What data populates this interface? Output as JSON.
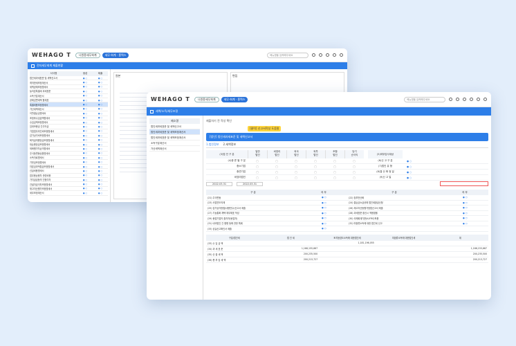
{
  "back": {
    "logo": "WEHAGO T",
    "pill": "나원종세무회계",
    "pill2": "세무·회계 · 홈택스",
    "bar_title": "전자세무회계 제출현황",
    "search": "메뉴명을 입력해주세요",
    "col1": "서식명",
    "col2": "생성",
    "col3": "제출",
    "panel2": "원본",
    "panel3": "편집",
    "rows": [
      "법인세과세표준 및 세액신고서",
      "최저한세조정계산서",
      "세액공제조정명세서",
      "농어촌특별세 과세표준",
      "소득구분계산서",
      "공제감면세액 합계표",
      "특별비용조정명세서",
      "가산세액계산서",
      "이월결손금명세서",
      "조정후수입금액명세서",
      "수입금액조정명세서",
      "임대보증금 간주익금",
      "기업업무추진비조정명세서",
      "감가상각비조정명세서",
      "퇴직급여충당금조정명세서",
      "대손충당금조정명세서",
      "외화평가차손익명세서",
      "주식등변동상황명세서",
      "소득자료명세서",
      "기부금조정명세서",
      "자본금과적립금조정명세서",
      "선급비용명세서",
      "업무용승용차 관련비용",
      "가지급금등의 인정이자",
      "건설자금이자조정명세서",
      "재고자산평가조정명세서",
      "세무조정계산서"
    ]
  },
  "front": {
    "logo": "WEHAGO T",
    "pill": "나원종세무회계",
    "pill2": "세무·회계 · 홈택스",
    "bar_title": "세액/소득/세무조정",
    "search": "메뉴명을 입력해주세요",
    "sub_title": "[법인] 법인세과세표준 및 세액신고서",
    "help": "제출하기 전 작성 확인",
    "tooltip": "[클릭] 신고서작성 도움말",
    "left_header": "제소명",
    "left_items": [
      "법인세과세표준 및 세액신고서",
      "법인세과세표준 및 세액조정계산서",
      "법인세과세표준 및 세액조정계산서",
      "소득구분계산서",
      "가산세액계산서"
    ],
    "tab1": "1.법인정보",
    "tab2": "2.세액정보",
    "section_label": "법인\n구분",
    "header_cols": [
      "일반\n법인",
      "비영리\n법인",
      "외국\n법인",
      "외투\n법인",
      "조합\n법인",
      "당기\n순이익"
    ],
    "r_labels": [
      "(3)법 인 구 분",
      "(4)종 류 별 구 분",
      "중소기업",
      "중견기업",
      "비영리법인",
      "(5)외부감사대상",
      "(6)신 고 구 분",
      "(7)법인 유 형",
      "(8)결 산 확 정 일",
      "(9)신 고 일",
      "(10)세무조정번호"
    ],
    "dates": [
      "2022.03.31",
      "2022.03.31"
    ],
    "mid_header": [
      "구 분",
      "여 부",
      "구 분",
      "여 부"
    ],
    "mid_rows": [
      [
        "(21) 주식변동",
        "(22) 장부전산화"
      ],
      [
        "(23) 사업연도의제",
        "(24) 결손금소급공제 법인세환급신청"
      ],
      [
        "(25) 감가상각방법(내용연수)신고서 제출",
        "(26) 재고자산등평가방법신고서 제출"
      ],
      [
        "(27) 기능통화 채택 재무제표 작성",
        "(28) 과세표준 환산시 적용환율"
      ],
      [
        "(29) 동업기업의 출자자(동업자)",
        "(30) 국제회계기준(K-IFRS)적용"
      ],
      [
        "(31) 내국법인 간 합병 등에 관한 특례",
        "(32) 미환류소득에 대한 법인세 신고"
      ],
      [
        "(33) 성실신고확인서 제출",
        ""
      ]
    ],
    "bottom_header": [
      "구분/법인세",
      "법 인 세",
      "토지등양도소득에 대한법인세",
      "미환류소득에 대한법인세",
      "계"
    ],
    "bottom_rows": [
      [
        "(33) 수 입 금 액",
        "",
        "1,181,196,055",
        "",
        ""
      ],
      [
        "(34) 과 세 표 준",
        "1,166,155,667",
        "",
        "",
        "1,166,155,667"
      ],
      [
        "(35) 산 출 세 액",
        "200,235,500",
        "",
        "",
        "200,235,500"
      ],
      [
        "(36) 총 부 담 세 액",
        "200,213,727",
        "",
        "",
        "200,213,727"
      ]
    ],
    "colors": {
      "accent": "#2d7ee8",
      "bg": "#e3eefb"
    }
  }
}
